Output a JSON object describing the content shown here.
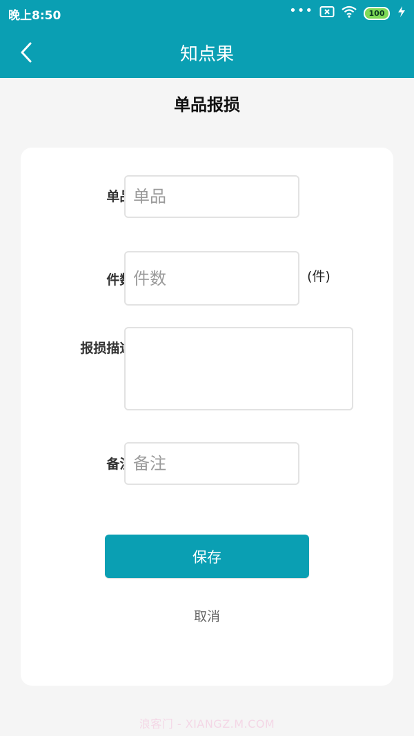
{
  "status_bar": {
    "time": "晚上8:50",
    "dots": "•••",
    "battery_level": "100",
    "icons": [
      "notification-x-icon",
      "wifi-icon",
      "battery-icon",
      "charging-icon"
    ]
  },
  "nav": {
    "title": "知点果",
    "back_icon": "chevron-left-icon"
  },
  "page": {
    "title": "单品报损"
  },
  "form": {
    "item": {
      "label": "单品:",
      "placeholder": "单品",
      "value": ""
    },
    "quantity": {
      "label": "件数:",
      "placeholder": "件数",
      "value": "",
      "unit": "(件)"
    },
    "description": {
      "label": "报损描述:",
      "value": ""
    },
    "remark": {
      "label": "备注:",
      "placeholder": "备注",
      "value": ""
    }
  },
  "actions": {
    "save_label": "保存",
    "cancel_label": "取消"
  },
  "watermark": "浪客门 - XIANGZ.M.COM",
  "colors": {
    "primary": "#0a9fb3",
    "background": "#f5f5f5",
    "card": "#ffffff"
  }
}
